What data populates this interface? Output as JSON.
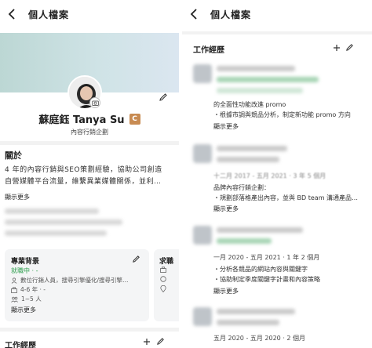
{
  "left": {
    "header_title": "個人檔案",
    "name": "蘇庭鈺 Tanya Su",
    "badge": "C",
    "headline": "內容行銷企劃",
    "about": {
      "heading": "關於",
      "text_line1": "4 年的內容行銷與SEO策劃經驗，協助公司創造",
      "text_line2": "自營媒體平台流量，維繫異業媒體關係，並利…",
      "more": "顯示更多"
    },
    "background_card": {
      "heading": "專業背景",
      "status": "就職中 · -",
      "role": "數位行銷人員，搜尋引擎優化/搜尋引擎…",
      "years": "4-6 年 · -",
      "team": "1~5 人",
      "more": "顯示更多"
    },
    "second_card": {
      "heading": "求職"
    },
    "experience_heading": "工作經歷"
  },
  "right": {
    "header_title": "個人檔案",
    "section_heading": "工作經歷",
    "entries": [
      {
        "desc1": "的全面性功能改進 promo",
        "desc2": "・根據市調與競品分析，制定新功能 promo 方向",
        "more": "顯示更多"
      },
      {
        "date": "十二月 2017 - 五月 2021 · 3 年 5 個月",
        "desc1": "品牌內容行銷企劃：",
        "desc2": "・規劃部落格產出內容，並與 BD team 溝通產品…",
        "more": "顯示更多"
      },
      {
        "date": "一月 2020 - 五月 2021 · 1 年 2 個月",
        "desc1": "・分析各競品的網站內容與關鍵字",
        "desc2": "・協助制定季度關鍵字計畫和內容策略",
        "more": "顯示更多"
      },
      {
        "date": "五月 2020 - 五月 2020 · 2 個月"
      }
    ]
  },
  "colors": {
    "accent_green": "#2a9d4a",
    "badge": "#c88b52",
    "banner": "#cfe3e6"
  }
}
